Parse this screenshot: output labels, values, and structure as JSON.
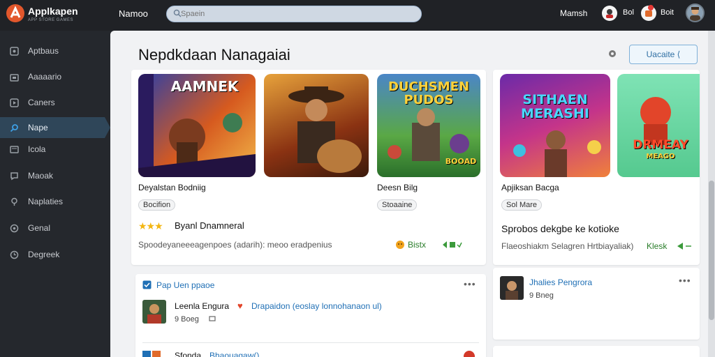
{
  "app": {
    "name": "Applkapen",
    "tagline": "APP STORE GAMES"
  },
  "topbar": {
    "nav_label": "Namoo",
    "search_placeholder": "Spaein",
    "user_label": "Mamsh",
    "item1_label": "Bol",
    "item2_label": "Boit"
  },
  "sidebar": {
    "items": [
      {
        "label": "Aptbaus",
        "icon": "grid-icon"
      },
      {
        "label": "Aaaaario",
        "icon": "store-icon"
      },
      {
        "label": "Caners",
        "icon": "gamepad-icon"
      },
      {
        "label": "Nape",
        "icon": "search-icon"
      },
      {
        "label": "Icola",
        "icon": "list-icon"
      },
      {
        "label": "Maoak",
        "icon": "message-icon"
      },
      {
        "label": "Naplaties",
        "icon": "location-icon"
      },
      {
        "label": "Genal",
        "icon": "settings-icon"
      },
      {
        "label": "Degreek",
        "icon": "clock-icon"
      }
    ],
    "active_index": 3
  },
  "main": {
    "title": "Nepdkdaan Nanagaiai",
    "action_button": "Uacaite ⟨",
    "games": [
      {
        "thumb_title": "AAMNEK",
        "title": "Deyalstan Bodniig",
        "tag": "Bocifion",
        "tag_rows": ""
      },
      {
        "thumb_title": "",
        "title": "",
        "tag": "",
        "tag_rows": ""
      },
      {
        "thumb_title": "DUCHSMEN PUDOS",
        "thumb_subtitle": "BOOAD",
        "title": "Deesn Bilg",
        "tag": "Stoaaine"
      },
      {
        "thumb_title": "SITHAEN MERASHI",
        "title": "Apjiksan Bacga",
        "tag": "Sol Mare"
      },
      {
        "thumb_title": "DRMEAY",
        "thumb_subtitle": "MEAGO",
        "title": "",
        "tag": ""
      }
    ],
    "rating_text": "Byanl Dnamneral",
    "rating_stars": 3,
    "left_desc": "Spoodeyaneeeagenpoes (adarih): meoo eradpenius",
    "left_status": "Bistx",
    "right_heading": "Sprobos dekgbe ke kotioke",
    "right_desc": "Flaeoshiakm Selagren Hrtbiayaliak)",
    "right_status": "Klesk",
    "panel_left": {
      "link": "Pap Uen ppaoe",
      "row_name": "Leenla Engura",
      "row_highlight": "Drapaidon (eoslay lonnohanaon ul)",
      "row_meta": "9 Boeg",
      "row2_name": "Sfonda",
      "row2_highlight": "Bhaouagaw()"
    },
    "panel_right": {
      "link": "Jhalies Pengrora",
      "meta": "9 Bneg"
    }
  },
  "colors": {
    "accent": "#e2572c",
    "link": "#1f6fb5",
    "active_nav": "#2f4659"
  }
}
